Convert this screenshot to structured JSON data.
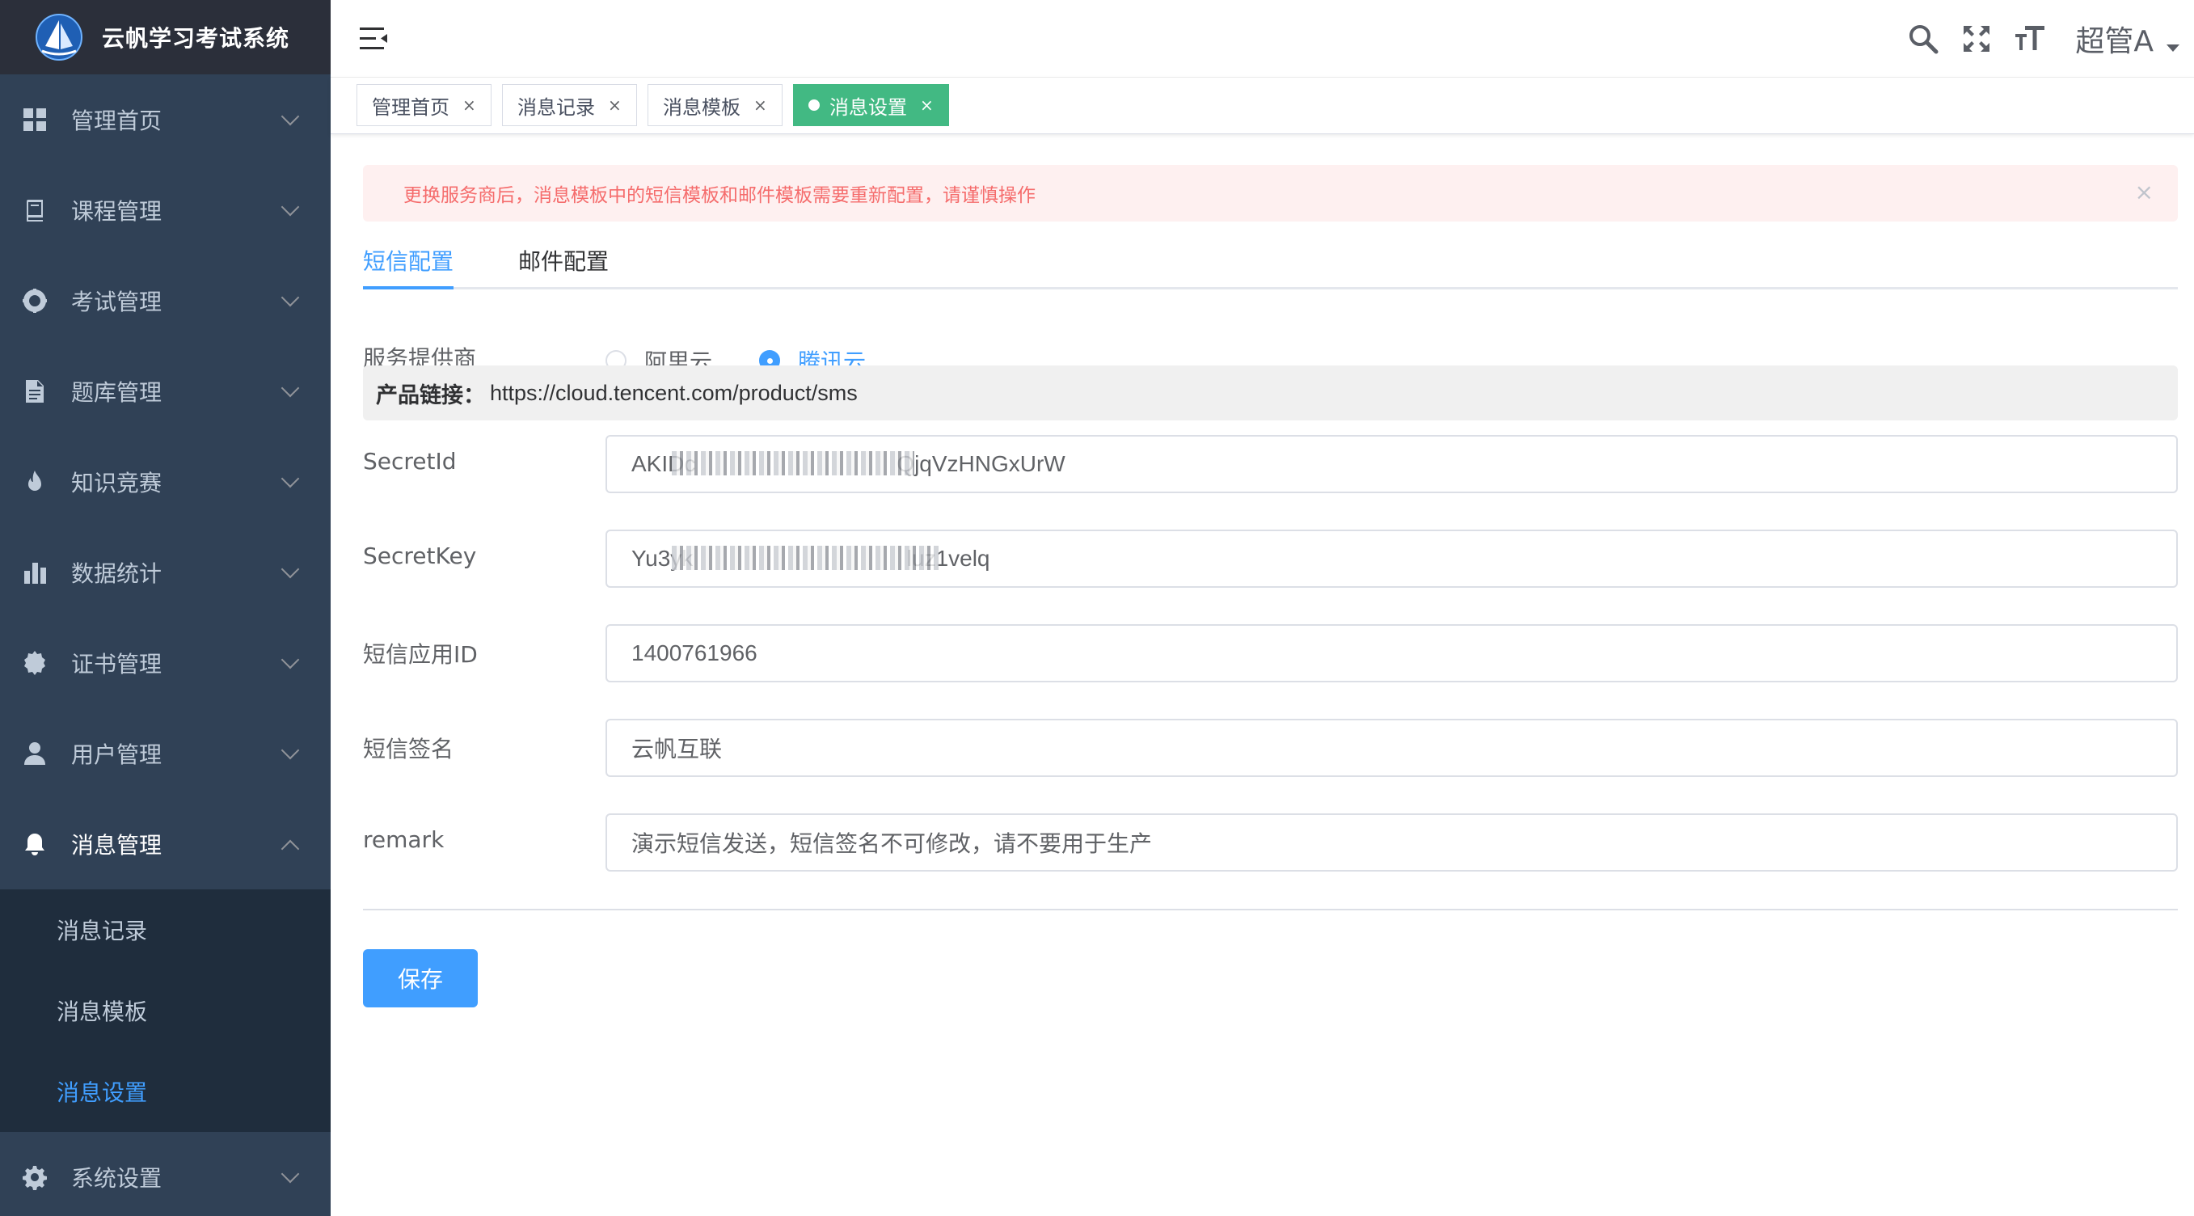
{
  "app": {
    "title": "云帆学习考试系统"
  },
  "sidebar": {
    "items": [
      {
        "label": "管理首页",
        "icon": "dashboard-icon"
      },
      {
        "label": "课程管理",
        "icon": "course-icon"
      },
      {
        "label": "考试管理",
        "icon": "exam-icon"
      },
      {
        "label": "题库管理",
        "icon": "question-bank-icon"
      },
      {
        "label": "知识竞赛",
        "icon": "fire-icon"
      },
      {
        "label": "数据统计",
        "icon": "bar-chart-icon"
      },
      {
        "label": "证书管理",
        "icon": "certificate-icon"
      },
      {
        "label": "用户管理",
        "icon": "user-icon"
      },
      {
        "label": "消息管理",
        "icon": "bell-icon",
        "expanded": true
      },
      {
        "label": "系统设置",
        "icon": "gear-icon"
      }
    ],
    "submenu": [
      {
        "label": "消息记录"
      },
      {
        "label": "消息模板"
      },
      {
        "label": "消息设置",
        "active": true
      }
    ]
  },
  "navbar": {
    "user_name": "超管A"
  },
  "tags": [
    {
      "label": "管理首页",
      "close": "×"
    },
    {
      "label": "消息记录",
      "close": "×"
    },
    {
      "label": "消息模板",
      "close": "×"
    },
    {
      "label": "消息设置",
      "close": "×",
      "active": true
    }
  ],
  "alert": {
    "text": "更换服务商后，消息模板中的短信模板和邮件模板需要重新配置，请谨慎操作",
    "close": "×"
  },
  "tabs": [
    {
      "label": "短信配置",
      "active": true
    },
    {
      "label": "邮件配置"
    }
  ],
  "form": {
    "provider_label": "服务提供商",
    "providers": [
      {
        "label": "阿里云",
        "checked": false
      },
      {
        "label": "腾讯云",
        "checked": true
      }
    ],
    "product_link_label": "产品链接：",
    "product_link_url": "https://cloud.tencent.com/product/sms",
    "fields": [
      {
        "label": "SecretId",
        "value": "AKIDc                                QjqVzHNGxUrW"
      },
      {
        "label": "SecretKey",
        "value": "Yu3yk                                  luz1velq"
      },
      {
        "label": "短信应用ID",
        "value": "1400761966"
      },
      {
        "label": "短信签名",
        "value": "云帆互联"
      },
      {
        "label": "remark",
        "value": "演示短信发送，短信签名不可修改，请不要用于生产"
      }
    ],
    "save_label": "保存"
  },
  "colors": {
    "sidebar_bg": "#304156",
    "submenu_bg": "#1f2d3d",
    "primary": "#409eff",
    "tag_active": "#42b983",
    "alert_bg": "#fef0f0",
    "alert_text": "#f56c6c"
  }
}
